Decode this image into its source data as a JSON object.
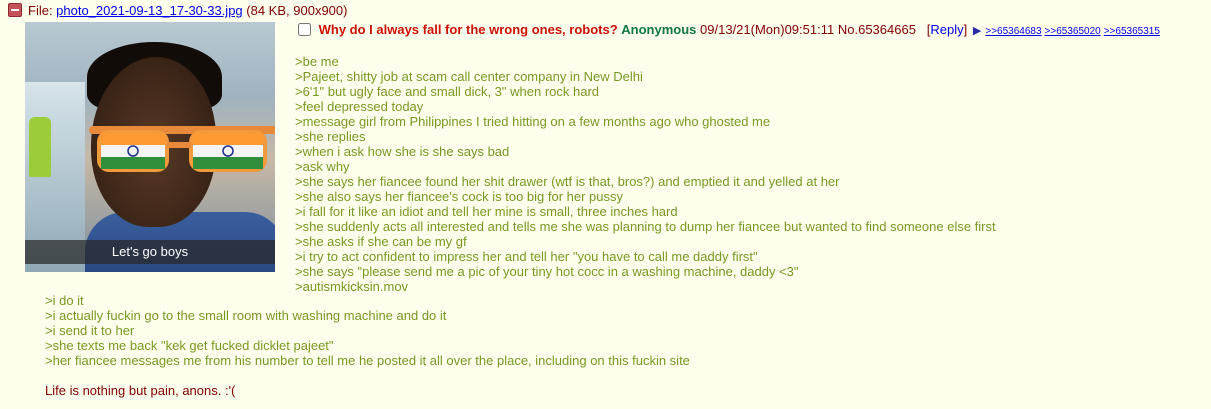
{
  "file": {
    "label": "File: ",
    "name": "photo_2021-09-13_17-30-33.jpg",
    "meta": " (84 KB, 900x900)"
  },
  "thumbnail": {
    "caption": "Let's go boys"
  },
  "post": {
    "subject": "Why do I always fall for the wrong ones, robots?",
    "name": "Anonymous",
    "datetime": "09/13/21(Mon)09:51:11",
    "number": "No.65364665",
    "reply_open": "[",
    "reply_label": "Reply",
    "reply_close": "]",
    "backlinks": [
      ">>65364683",
      ">>65365020",
      ">>65365315"
    ]
  },
  "body": {
    "lines_top": [
      ">be me",
      ">Pajeet, shitty job at scam call center company in New Delhi",
      ">6'1\" but ugly face and small dick, 3\" when rock hard",
      ">feel depressed today",
      ">message girl from Philippines I tried hitting on a few months ago who ghosted me",
      ">she replies",
      ">when i ask how she is she says bad",
      ">ask why",
      ">she says her fiancee found her shit drawer (wtf is that, bros?) and emptied it and yelled at her",
      ">she also says her fiancee's cock is too big for her pussy",
      ">i fall for it like an idiot and tell her mine is small, three inches hard",
      ">she suddenly acts all interested and tells me she was planning to dump her fiancee but wanted to find someone else first",
      ">she asks if she can be my gf",
      ">i try to act confident to impress her and tell her \"you have to call me daddy first\"",
      ">she says \"please send me a pic of your tiny hot cocc in a washing machine, daddy <3\"",
      ">autismkicksin.mov"
    ],
    "lines_bottom": [
      ">i do it",
      ">i actually fuckin go to the small room with washing machine and do it",
      ">i send it to her",
      ">she texts me back \"kek get fucked dicklet pajeet\"",
      ">her fiancee messages me from his number to tell me he posted it all over the place, including on this fuckin site"
    ],
    "final_line": "Life is nothing but pain, anons. :'("
  },
  "colors": {
    "background": "#ffffee",
    "text": "#800000",
    "subject": "#cc1105",
    "name": "#117743",
    "greentext": "#789922",
    "link": "#0000ee"
  }
}
